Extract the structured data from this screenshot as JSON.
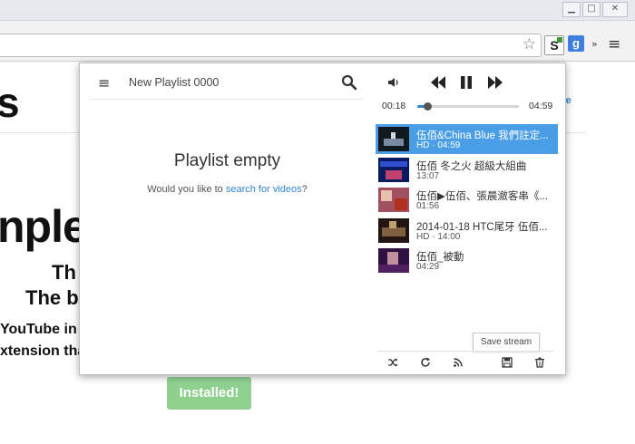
{
  "window": {
    "minimize": "▁",
    "maximize": "□",
    "close": "✕"
  },
  "toolbar": {
    "star_icon": "star-icon",
    "ext_s_label": "S",
    "ext_g_label": "g",
    "more": "»",
    "menu": "≡"
  },
  "background": {
    "heading_fragment": "s",
    "link_fragment": "te",
    "big_word": "nple",
    "line1": "Th",
    "line2": "The b",
    "para1": "YouTube in",
    "para2": "xtension tha",
    "installed_button": "Installed!"
  },
  "popup": {
    "menu_icon": "≡",
    "playlist_name": "New Playlist 0000",
    "empty_title": "Playlist empty",
    "empty_prefix": "Would you like to ",
    "empty_link": "search for videos",
    "empty_suffix": "?",
    "current_time": "00:18",
    "total_time": "04:59",
    "progress": 0.1,
    "videos": [
      {
        "title": "伍佰&China Blue 我們註定...",
        "meta": "HD · 04:59"
      },
      {
        "title": "伍佰 冬之火 超級大組曲",
        "meta": "13:07"
      },
      {
        "title": "伍佰▶伍佰、張晨瀲客串《...",
        "meta": "01:56"
      },
      {
        "title": "2014-01-18 HTC尾牙 伍佰...",
        "meta": "HD · 14:00"
      },
      {
        "title": "伍佰_被動",
        "meta": "04:29"
      }
    ],
    "tooltip": "Save stream",
    "accent": "#4a9ee6"
  }
}
